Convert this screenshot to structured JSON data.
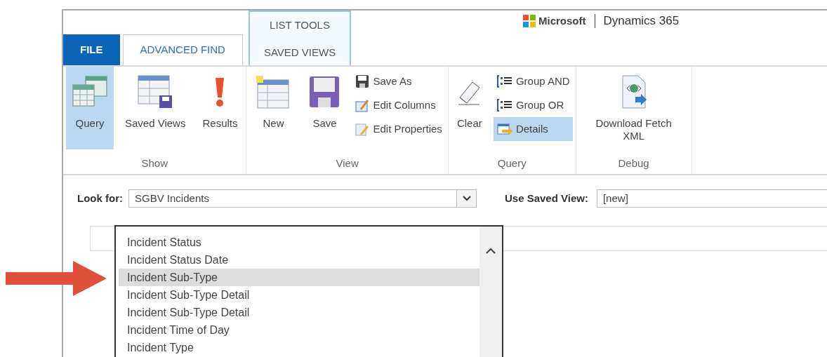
{
  "header": {
    "brand": "Microsoft",
    "product": "Dynamics 365"
  },
  "tabs": [
    {
      "label": "FILE",
      "kind": "file",
      "selected": false
    },
    {
      "label": "ADVANCED FIND",
      "kind": "tab",
      "selected": true
    }
  ],
  "contextual_tab": {
    "group_label": "LIST TOOLS",
    "label": "SAVED VIEWS",
    "selected": false
  },
  "ribbon_groups": [
    {
      "label": "Show",
      "buttons": [
        {
          "label": "Query",
          "kind": "query",
          "selected": true
        },
        {
          "label": "Saved Views",
          "kind": "views",
          "selected": false
        },
        {
          "label": "Results",
          "kind": "results",
          "selected": false
        }
      ]
    },
    {
      "label": "View",
      "buttons": [
        {
          "label": "New",
          "kind": "new",
          "selected": false
        },
        {
          "label": "Save",
          "kind": "save",
          "selected": false
        },
        {
          "label": "Save As",
          "kind": "saveas",
          "selected": false
        },
        {
          "label": "Edit Columns",
          "kind": "columns",
          "selected": false
        },
        {
          "label": "Edit Properties",
          "kind": "properties",
          "selected": false
        }
      ]
    },
    {
      "label": "Query",
      "buttons": [
        {
          "label": "Clear",
          "kind": "clear",
          "selected": false
        },
        {
          "label": "Group AND",
          "kind": "group",
          "selected": false
        },
        {
          "label": "Group OR",
          "kind": "group",
          "selected": false
        },
        {
          "label": "Details",
          "kind": "details",
          "selected": true
        }
      ]
    },
    {
      "label": "Debug",
      "buttons": [
        {
          "label": "Download Fetch XML",
          "kind": "fetch",
          "selected": false
        }
      ]
    }
  ],
  "look_for": {
    "label": "Look for:",
    "value": "SGBV Incidents"
  },
  "saved_view": {
    "label": "Use Saved View:",
    "value": "[new]"
  },
  "field_list": [
    {
      "label": "Incident Status",
      "selected": false
    },
    {
      "label": "Incident Status Date",
      "selected": false
    },
    {
      "label": "Incident Sub-Type",
      "selected": true
    },
    {
      "label": "Incident Sub-Type Detail",
      "selected": false
    },
    {
      "label": "Incident Sub-Type Detail",
      "selected": false
    },
    {
      "label": "Incident Time of Day",
      "selected": false
    },
    {
      "label": "Incident Type",
      "selected": false
    }
  ]
}
